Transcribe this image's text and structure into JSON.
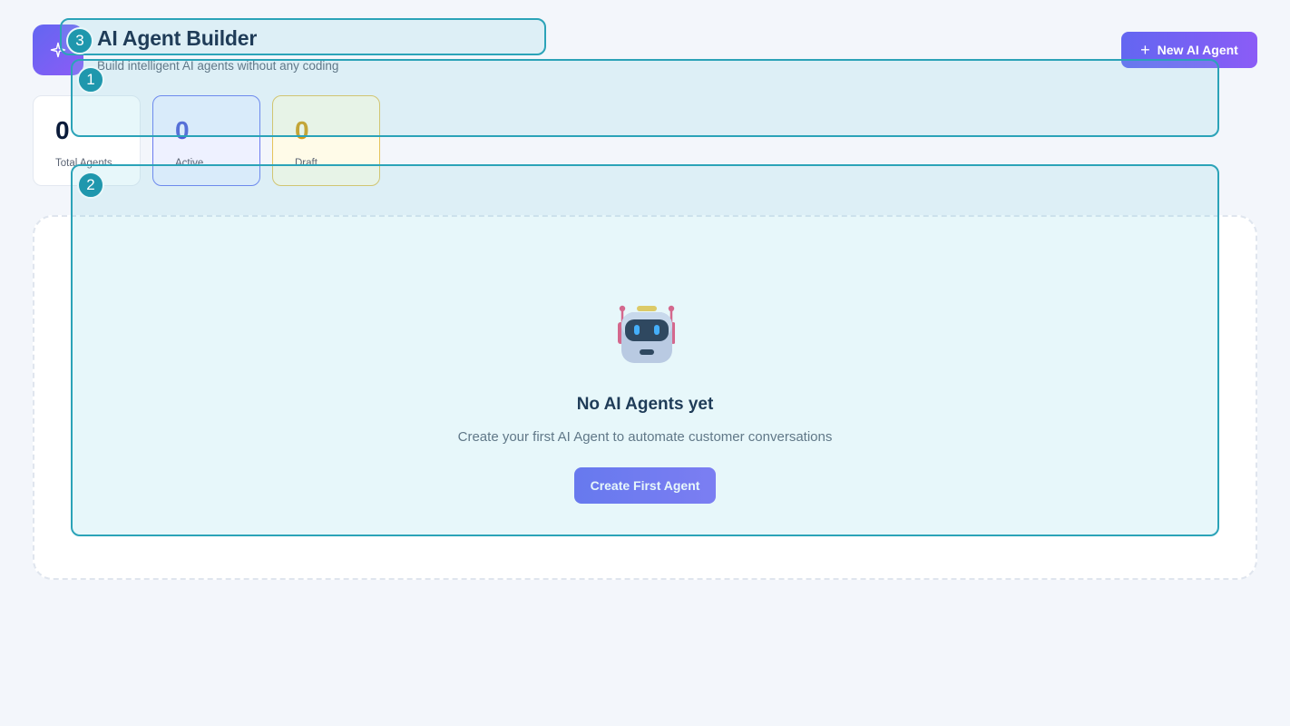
{
  "header": {
    "title": "AI Agent Builder",
    "subtitle": "Build intelligent AI agents without any coding",
    "logo_icon": "sparkle-icon",
    "new_agent_label": "New AI Agent"
  },
  "stats": [
    {
      "value": "0",
      "label": "Total Agents"
    },
    {
      "value": "0",
      "label": "Active"
    },
    {
      "value": "0",
      "label": "Draft"
    }
  ],
  "empty_state": {
    "icon": "robot-icon",
    "title": "No AI Agents yet",
    "description": "Create your first AI Agent to automate customer conversations",
    "button_label": "Create First Agent"
  },
  "annotations": [
    "1",
    "2",
    "3"
  ],
  "colors": {
    "accent_start": "#6366f1",
    "accent_end": "#8b5cf6",
    "active": "#4f5bd5",
    "draft": "#d39b13",
    "overlay": "#2ba3b8"
  }
}
